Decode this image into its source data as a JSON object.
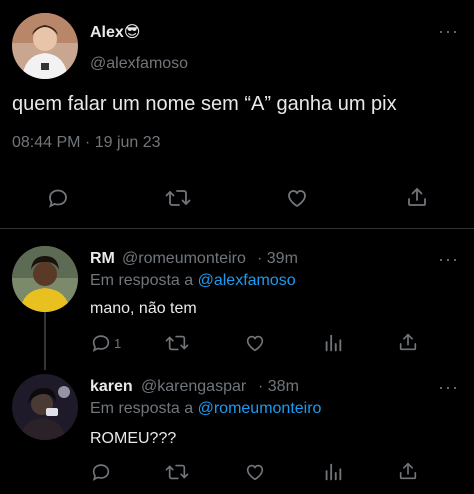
{
  "main_tweet": {
    "display_name": "Alex",
    "display_emoji": "😎",
    "handle": "@alexfamoso",
    "text": "quem falar um nome sem “A” ganha um pix",
    "timestamp": "08:44 PM · 19 jun 23",
    "more_label": "···"
  },
  "replies": [
    {
      "display_name": "RM",
      "handle": "@romeumonteiro",
      "time": "· 39m",
      "reply_to_prefix": "Em resposta a ",
      "reply_to_handle": "@alexfamoso",
      "text": "mano, não tem",
      "reply_count": "1",
      "more_label": "···"
    },
    {
      "display_name": "karen",
      "handle": "@karengaspar",
      "time": "· 38m",
      "reply_to_prefix": "Em resposta a ",
      "reply_to_handle": "@romeumonteiro",
      "text": "ROMEU???",
      "reply_count": "",
      "more_label": "···"
    }
  ],
  "colors": {
    "background": "#000000",
    "text_primary": "#e7e9ea",
    "text_secondary": "#71767b",
    "link": "#1d9bf0",
    "divider": "#2f3336"
  },
  "icons": {
    "reply": "reply-icon",
    "retweet": "retweet-icon",
    "like": "heart-icon",
    "views": "views-icon",
    "share": "share-icon",
    "more": "more-options-icon"
  }
}
